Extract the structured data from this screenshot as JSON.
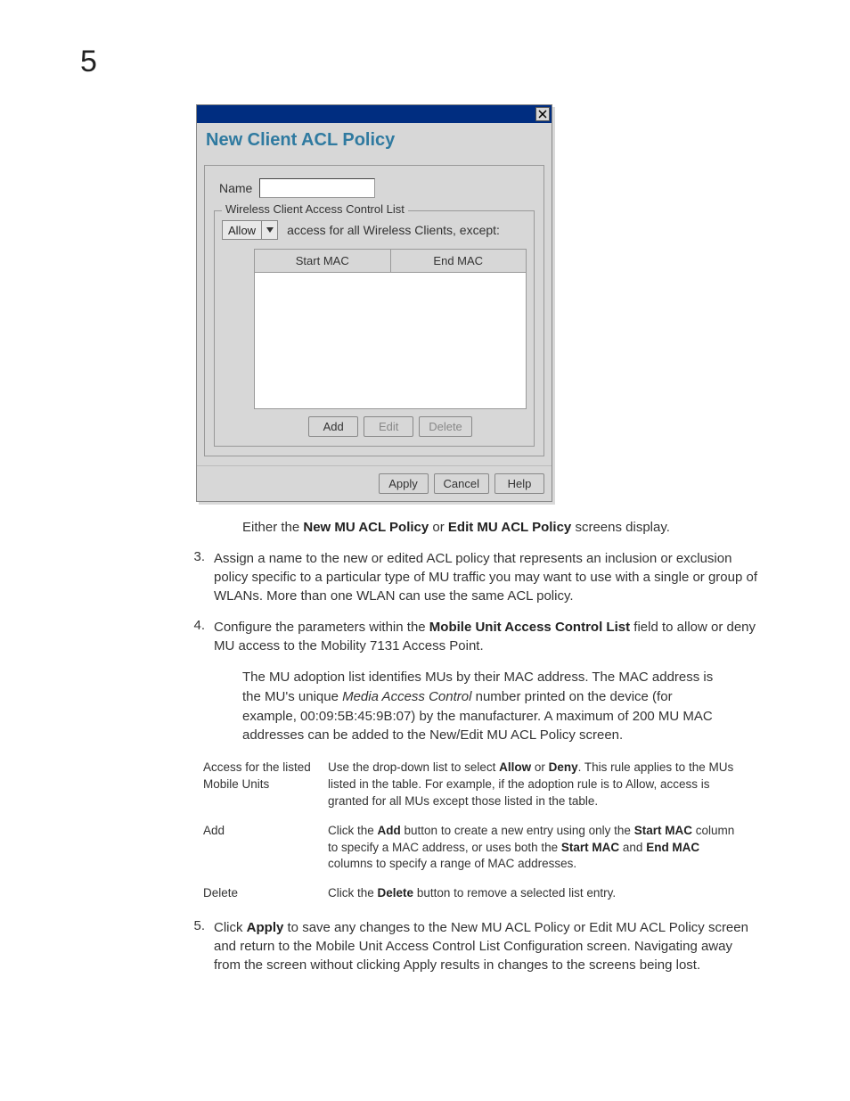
{
  "chapterNumber": "5",
  "dialog": {
    "heading": "New Client ACL Policy",
    "nameLabel": "Name",
    "nameValue": "",
    "fieldsetLegend": "Wireless Client Access Control List",
    "accessSelect": "Allow",
    "accessText": "access for all Wireless Clients, except:",
    "columns": {
      "start": "Start MAC",
      "end": "End MAC"
    },
    "buttons": {
      "add": "Add",
      "edit": "Edit",
      "delete": "Delete"
    },
    "footerButtons": {
      "apply": "Apply",
      "cancel": "Cancel",
      "help": "Help"
    }
  },
  "caption": {
    "pre": "Either the ",
    "b1": "New MU ACL Policy",
    "mid": " or ",
    "b2": "Edit MU ACL Policy",
    "post": " screens display."
  },
  "steps": {
    "s3": {
      "num": "3.",
      "text": "Assign a name to the new or edited ACL policy that represents an inclusion or exclusion policy specific to a particular type of MU traffic you may want to use with a single or group of WLANs. More than one WLAN can use the same ACL policy."
    },
    "s4": {
      "num": "4.",
      "pre": "Configure the parameters within the ",
      "b1": "Mobile Unit Access Control List",
      "post": " field to allow or deny MU access to the Mobility 7131 Access Point."
    },
    "s5": {
      "num": "5.",
      "pre": "Click ",
      "b1": "Apply",
      "post": " to save any changes to the New MU ACL Policy or Edit MU ACL Policy screen and return to the Mobile Unit Access Control List Configuration screen. Navigating away from the screen without clicking Apply results in changes to the screens being lost."
    }
  },
  "note": {
    "pre": "The MU adoption list identifies MUs by their MAC address. The MAC address is the MU's unique ",
    "i1": "Media Access Control",
    "post": " number printed on the device (for example, 00:09:5B:45:9B:07) by the manufacturer. A maximum of 200 MU MAC addresses can be added to the New/Edit MU ACL Policy screen."
  },
  "defs": {
    "row1": {
      "term": "Access for the listed Mobile Units",
      "pre": "Use the drop-down list to select ",
      "b1": "Allow",
      "mid1": " or ",
      "b2": "Deny",
      "post": ". This rule applies to the MUs listed in the table. For example, if the adoption rule is to Allow, access is granted for all MUs except those listed in the table."
    },
    "row2": {
      "term": "Add",
      "pre": "Click the ",
      "b1": "Add",
      "mid1": " button to create a new entry using only the ",
      "b2": "Start MAC",
      "mid2": " column to specify a MAC address, or uses both the ",
      "b3": "Start MAC",
      "mid3": " and ",
      "b4": "End MAC",
      "post": " columns to specify a range of MAC addresses."
    },
    "row3": {
      "term": "Delete",
      "pre": "Click the ",
      "b1": "Delete",
      "post": " button to remove a selected list entry."
    }
  }
}
